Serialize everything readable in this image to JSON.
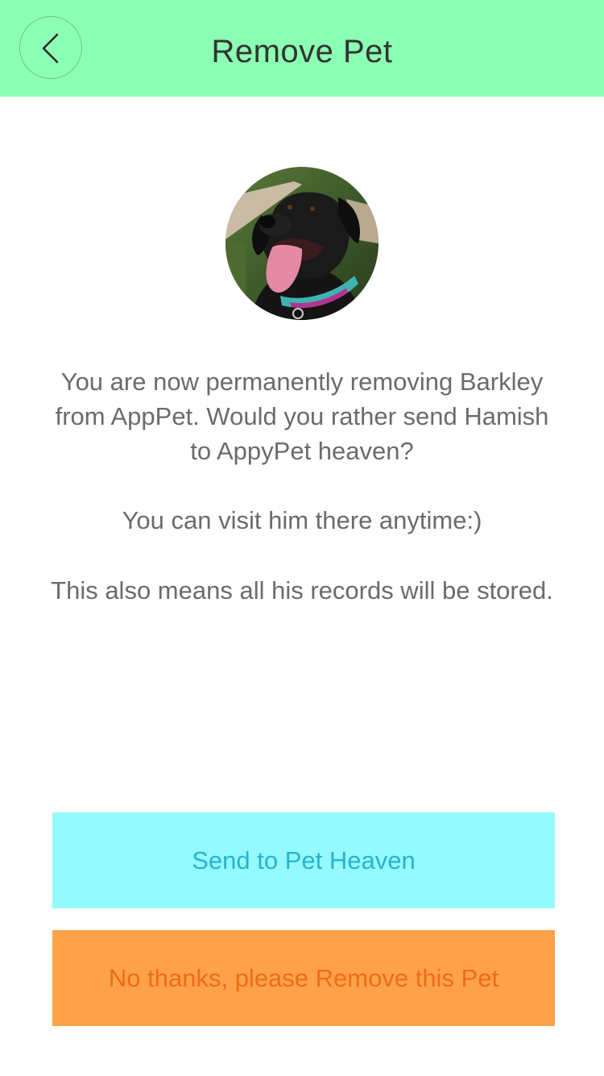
{
  "header": {
    "title": "Remove Pet",
    "back_icon": "chevron-left-icon",
    "background_color": "#8bffb3"
  },
  "pet": {
    "avatar": "dog-photo"
  },
  "message": {
    "paragraph1": "You are now permanently removing Barkley from AppPet. Would you rather send Hamish to AppyPet heaven?",
    "paragraph2": "You can visit him there anytime:)",
    "paragraph3": "This also means all his records will be stored."
  },
  "actions": {
    "heaven_label": "Send to Pet Heaven",
    "heaven_color": "#94fafd",
    "remove_label": "No thanks, please Remove this Pet",
    "remove_color": "#fea249"
  }
}
